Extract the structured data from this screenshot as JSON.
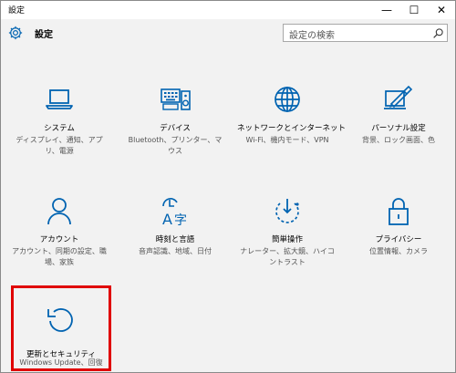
{
  "window": {
    "title": "設定",
    "controls": {
      "minimize": "—",
      "maximize": "☐",
      "close": "✕"
    }
  },
  "header": {
    "title": "設定",
    "search_placeholder": "設定の検索"
  },
  "tiles": [
    {
      "label": "システム",
      "desc": "ディスプレイ、通知、アプリ、電源",
      "icon": "laptop-icon"
    },
    {
      "label": "デバイス",
      "desc": "Bluetooth、プリンター、マウス",
      "icon": "keyboard-speaker-icon"
    },
    {
      "label": "ネットワークとインターネット",
      "desc": "Wi-Fi、機内モード、VPN",
      "icon": "globe-icon"
    },
    {
      "label": "パーソナル設定",
      "desc": "背景、ロック画面、色",
      "icon": "paint-monitor-icon"
    },
    {
      "label": "アカウント",
      "desc": "アカウント、同期の設定、職場、家族",
      "icon": "person-icon"
    },
    {
      "label": "時刻と言語",
      "desc": "音声認識、地域、日付",
      "icon": "time-language-icon"
    },
    {
      "label": "簡単操作",
      "desc": "ナレーター、拡大鏡、ハイコントラスト",
      "icon": "ease-of-access-icon"
    },
    {
      "label": "プライバシー",
      "desc": "位置情報、カメラ",
      "icon": "lock-icon"
    },
    {
      "label": "更新とセキュリティ",
      "desc": "Windows Update、回復",
      "icon": "refresh-icon"
    }
  ],
  "colors": {
    "accent": "#0063b1",
    "highlight": "#e00000",
    "background": "#f2f2f2"
  }
}
